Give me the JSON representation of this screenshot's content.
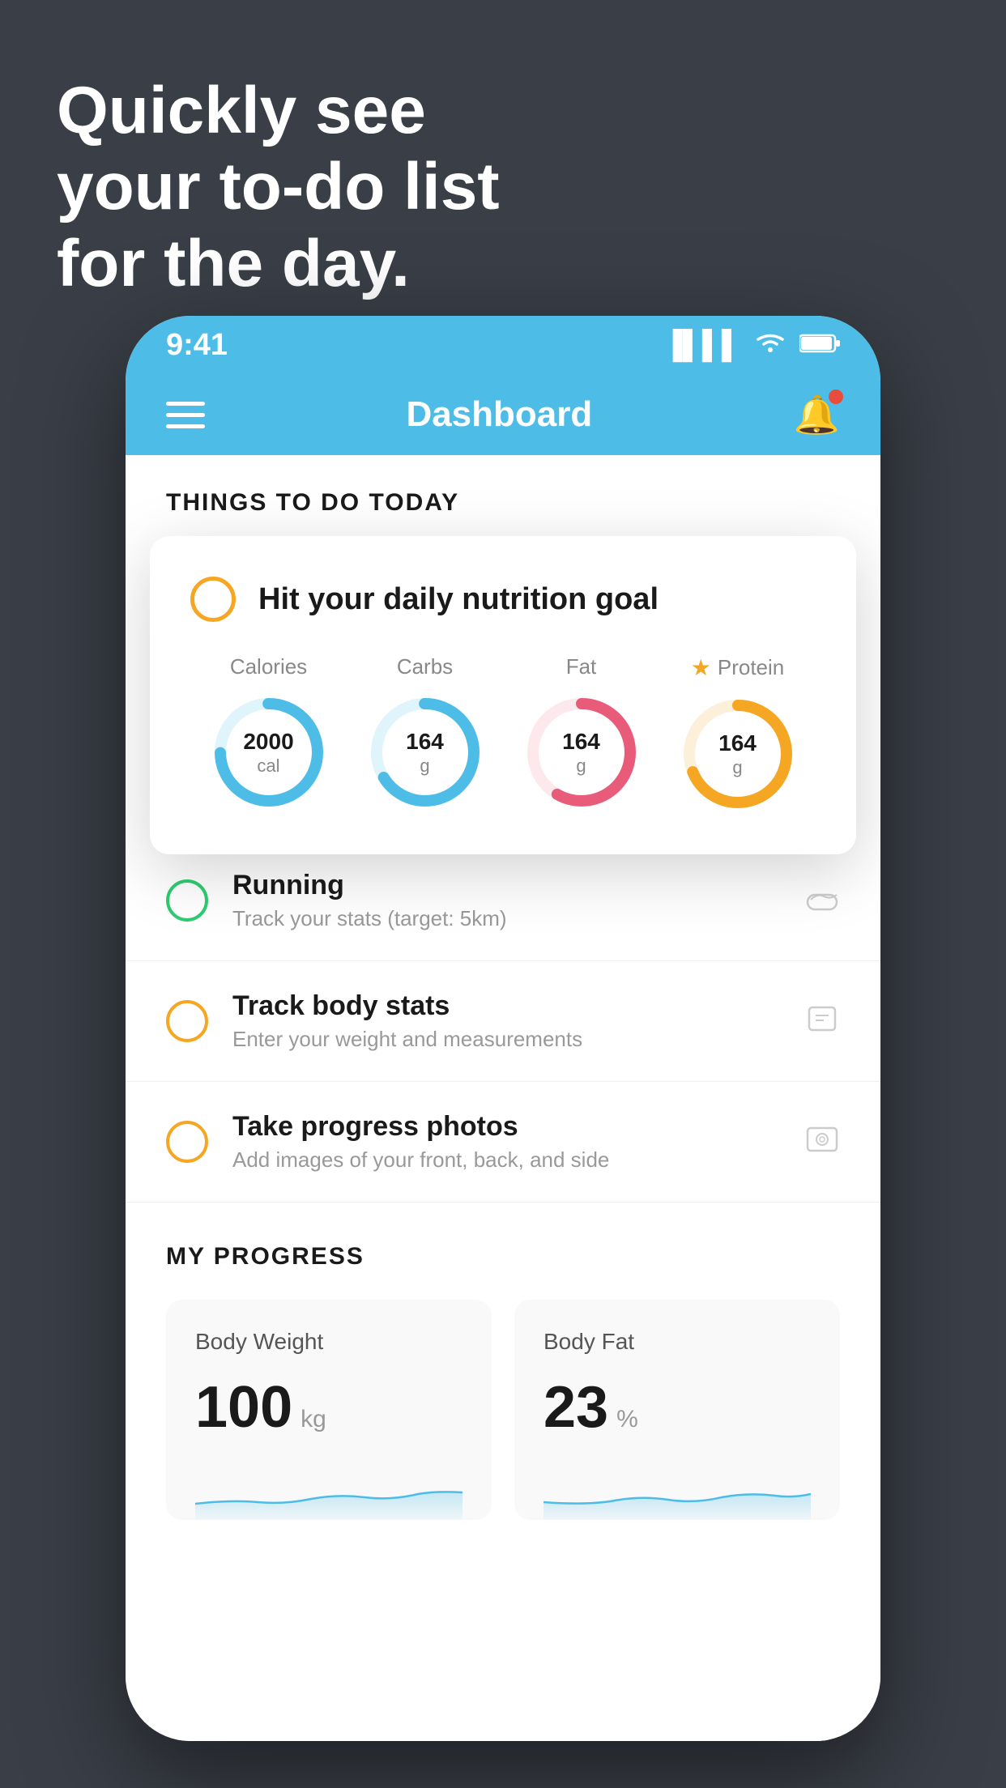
{
  "headline": {
    "line1": "Quickly see",
    "line2": "your to-do list",
    "line3": "for the day."
  },
  "statusBar": {
    "time": "9:41"
  },
  "navBar": {
    "title": "Dashboard"
  },
  "thingsHeader": "THINGS TO DO TODAY",
  "floatingCard": {
    "title": "Hit your daily nutrition goal",
    "nutrition": [
      {
        "label": "Calories",
        "value": "2000",
        "unit": "cal",
        "color": "#4dbde8",
        "track": "#e0f4fb",
        "starred": false
      },
      {
        "label": "Carbs",
        "value": "164",
        "unit": "g",
        "color": "#4dbde8",
        "track": "#e0f4fb",
        "starred": false
      },
      {
        "label": "Fat",
        "value": "164",
        "unit": "g",
        "color": "#e85c7a",
        "track": "#fde8ec",
        "starred": false
      },
      {
        "label": "Protein",
        "value": "164",
        "unit": "g",
        "color": "#f5a623",
        "track": "#fdf0db",
        "starred": true
      }
    ]
  },
  "todoItems": [
    {
      "title": "Running",
      "subtitle": "Track your stats (target: 5km)",
      "checkColor": "green",
      "icon": "👟"
    },
    {
      "title": "Track body stats",
      "subtitle": "Enter your weight and measurements",
      "checkColor": "yellow",
      "icon": "⚖️"
    },
    {
      "title": "Take progress photos",
      "subtitle": "Add images of your front, back, and side",
      "checkColor": "yellow",
      "icon": "🖼️"
    }
  ],
  "myProgress": {
    "header": "MY PROGRESS",
    "cards": [
      {
        "title": "Body Weight",
        "value": "100",
        "unit": "kg"
      },
      {
        "title": "Body Fat",
        "value": "23",
        "unit": "%"
      }
    ]
  }
}
